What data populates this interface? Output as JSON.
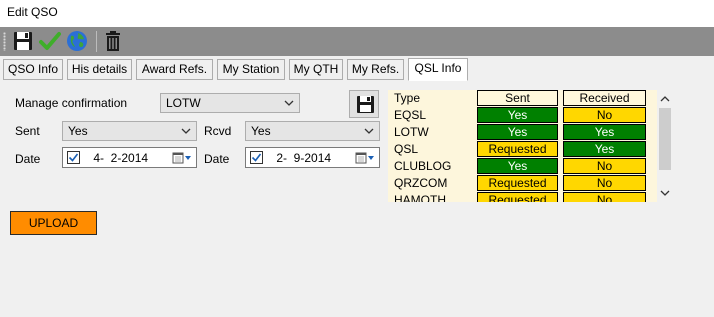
{
  "window": {
    "title": "Edit QSO"
  },
  "toolbar": {
    "buttons": [
      {
        "icon": "save-icon"
      },
      {
        "icon": "check-icon"
      },
      {
        "icon": "globe-icon"
      },
      {
        "icon": "trash-icon"
      }
    ]
  },
  "tabs": [
    {
      "label": "QSO Info",
      "active": false
    },
    {
      "label": "His details",
      "active": false
    },
    {
      "label": "Award Refs.",
      "active": false
    },
    {
      "label": "My Station",
      "active": false
    },
    {
      "label": "My QTH",
      "active": false
    },
    {
      "label": "My Refs.",
      "active": false
    },
    {
      "label": "QSL Info",
      "active": true
    }
  ],
  "form": {
    "manage_label": "Manage confirmation",
    "manage_value": "LOTW",
    "sent_label": "Sent",
    "sent_value": "Yes",
    "rcvd_label": "Rcvd",
    "rcvd_value": "Yes",
    "date_label": "Date",
    "sent_date": " 4-  2-2014",
    "rcvd_date": " 2-  9-2014",
    "sent_date_checked": true,
    "rcvd_date_checked": true,
    "upload_label": "UPLOAD"
  },
  "qsl_table": {
    "headers": {
      "type": "Type",
      "sent": "Sent",
      "received": "Received"
    },
    "rows": [
      {
        "type": "EQSL",
        "sent": "Yes",
        "received": "No"
      },
      {
        "type": "LOTW",
        "sent": "Yes",
        "received": "Yes"
      },
      {
        "type": "QSL",
        "sent": "Requested",
        "received": "Yes"
      },
      {
        "type": "CLUBLOG",
        "sent": "Yes",
        "received": "No"
      },
      {
        "type": "QRZCOM",
        "sent": "Requested",
        "received": "No"
      },
      {
        "type": "HAMQTH",
        "sent": "Requested",
        "received": "No"
      }
    ]
  },
  "colors": {
    "yes": "#008000",
    "other": "#ffd700",
    "upload": "#ff8c00",
    "table_bg": "#fdf6dc"
  }
}
